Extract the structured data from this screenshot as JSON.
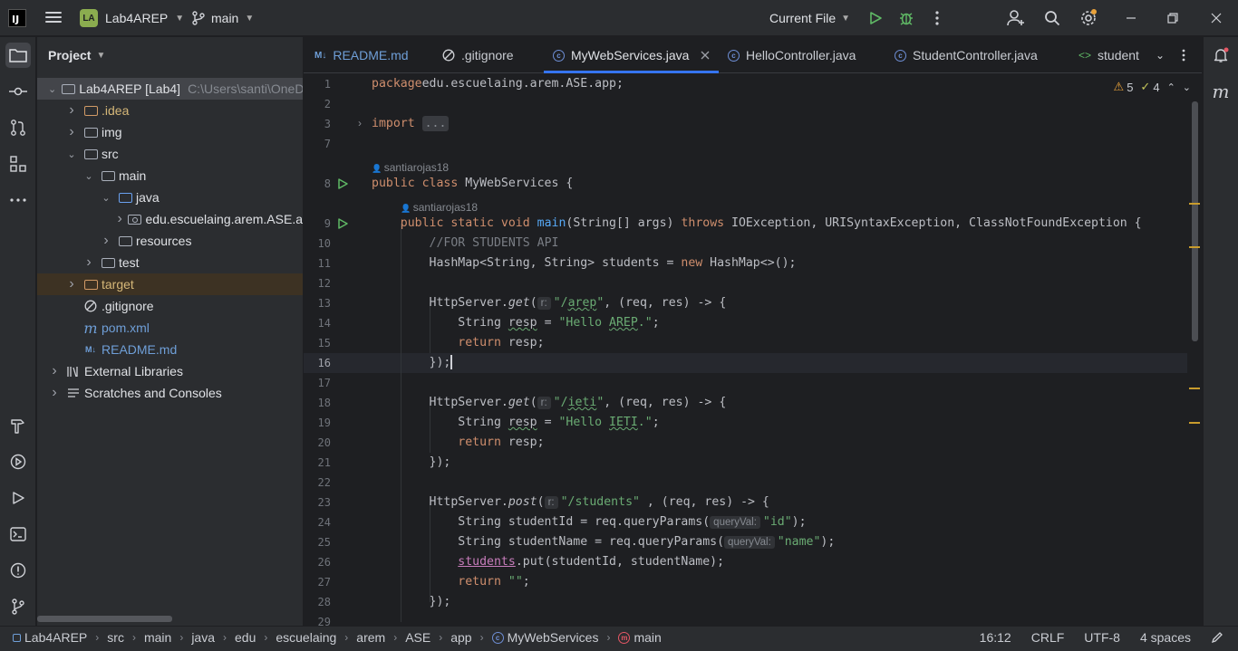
{
  "titlebar": {
    "logo": "IJ",
    "project_badge": "LA",
    "project_name": "Lab4AREP",
    "branch": "main",
    "run_config": "Current File"
  },
  "project_panel": {
    "title": "Project",
    "tree": [
      {
        "label": "Lab4AREP [Lab4]",
        "path": "C:\\Users\\santi\\OneD",
        "depth": 0,
        "expanded": true,
        "type": "module"
      },
      {
        "label": ".idea",
        "depth": 1,
        "expanded": false,
        "type": "folder-orange"
      },
      {
        "label": "img",
        "depth": 1,
        "expanded": false,
        "type": "folder"
      },
      {
        "label": "src",
        "depth": 1,
        "expanded": true,
        "type": "folder"
      },
      {
        "label": "main",
        "depth": 2,
        "expanded": true,
        "type": "folder"
      },
      {
        "label": "java",
        "depth": 3,
        "expanded": true,
        "type": "folder-blue"
      },
      {
        "label": "edu.escuelaing.arem.ASE.a",
        "depth": 4,
        "expanded": false,
        "type": "package"
      },
      {
        "label": "resources",
        "depth": 3,
        "expanded": false,
        "type": "folder"
      },
      {
        "label": "test",
        "depth": 2,
        "expanded": false,
        "type": "folder"
      },
      {
        "label": "target",
        "depth": 1,
        "expanded": false,
        "type": "folder-excluded"
      },
      {
        "label": ".gitignore",
        "depth": 1,
        "type": "gitignore"
      },
      {
        "label": "pom.xml",
        "depth": 1,
        "type": "maven"
      },
      {
        "label": "README.md",
        "depth": 1,
        "type": "markdown"
      },
      {
        "label": "External Libraries",
        "depth": 0,
        "expanded": false,
        "type": "libraries"
      },
      {
        "label": "Scratches and Consoles",
        "depth": 0,
        "expanded": false,
        "type": "scratches"
      }
    ]
  },
  "tabs": [
    {
      "label": "README.md",
      "icon": "markdown-icon",
      "active": false
    },
    {
      "label": ".gitignore",
      "icon": "gitignore-icon",
      "active": false
    },
    {
      "label": "MyWebServices.java",
      "icon": "class-icon",
      "active": true
    },
    {
      "label": "HelloController.java",
      "icon": "class-icon",
      "active": false
    },
    {
      "label": "StudentController.java",
      "icon": "class-icon",
      "active": false
    },
    {
      "label": "student",
      "icon": "html-icon",
      "active": false
    }
  ],
  "editor": {
    "warnings": "5",
    "weak_warnings": "4",
    "current_line": "16",
    "authors": [
      "santiarojas18",
      "santiarojas18"
    ],
    "lines": [
      {
        "n": "1",
        "tokens": [
          [
            "kw",
            "package"
          ],
          [
            "",
            "edu.escuelaing.arem.ASE.app;"
          ]
        ]
      },
      {
        "n": "2",
        "tokens": []
      },
      {
        "n": "3",
        "tokens": [
          [
            "kw",
            "import"
          ],
          [
            "",
            " "
          ],
          [
            "fold",
            "..."
          ]
        ]
      },
      {
        "n": "7",
        "tokens": []
      },
      {
        "n": "8",
        "tokens": [
          [
            "kw",
            "public class"
          ],
          [
            "",
            " MyWebServices {"
          ]
        ]
      },
      {
        "n": "9",
        "tokens": [
          [
            "",
            "    "
          ],
          [
            "kw",
            "public static void"
          ],
          [
            "",
            " "
          ],
          [
            "fn",
            "main"
          ],
          [
            "",
            "(String[] args) "
          ],
          [
            "kw",
            "throws"
          ],
          [
            "",
            " IOException, URISyntaxException, ClassNotFoundException {"
          ]
        ]
      },
      {
        "n": "10",
        "tokens": [
          [
            "",
            "        "
          ],
          [
            "cm",
            "//FOR STUDENTS API"
          ]
        ]
      },
      {
        "n": "11",
        "tokens": [
          [
            "",
            "        HashMap<String, String> students = "
          ],
          [
            "kw",
            "new"
          ],
          [
            "",
            " HashMap<>();"
          ]
        ]
      },
      {
        "n": "12",
        "tokens": []
      },
      {
        "n": "13",
        "tokens": [
          [
            "",
            "        HttpServer."
          ],
          [
            "it",
            "get"
          ],
          [
            "",
            "("
          ],
          [
            "hint",
            "r:"
          ],
          [
            "str",
            "\"/"
          ],
          [
            "strtypo",
            "arep"
          ],
          [
            "str",
            "\""
          ],
          [
            "",
            ", (req, res) -> {"
          ]
        ]
      },
      {
        "n": "14",
        "tokens": [
          [
            "",
            "            String "
          ],
          [
            "typo",
            "resp"
          ],
          [
            "",
            " = "
          ],
          [
            "str",
            "\"Hello "
          ],
          [
            "strtypo",
            "AREP"
          ],
          [
            "str",
            ".\""
          ],
          [
            "",
            ";"
          ]
        ]
      },
      {
        "n": "15",
        "tokens": [
          [
            "",
            "            "
          ],
          [
            "kw",
            "return"
          ],
          [
            "",
            " resp;"
          ]
        ]
      },
      {
        "n": "16",
        "tokens": [
          [
            "",
            "        });"
          ],
          [
            "caret",
            ""
          ]
        ]
      },
      {
        "n": "17",
        "tokens": []
      },
      {
        "n": "18",
        "tokens": [
          [
            "",
            "        HttpServer."
          ],
          [
            "it",
            "get"
          ],
          [
            "",
            "("
          ],
          [
            "hint",
            "r:"
          ],
          [
            "str",
            "\"/"
          ],
          [
            "strtypo",
            "ieti"
          ],
          [
            "str",
            "\""
          ],
          [
            "",
            ", (req, res) -> {"
          ]
        ]
      },
      {
        "n": "19",
        "tokens": [
          [
            "",
            "            String "
          ],
          [
            "typo",
            "resp"
          ],
          [
            "",
            " = "
          ],
          [
            "str",
            "\"Hello "
          ],
          [
            "strtypo",
            "IETI"
          ],
          [
            "str",
            ".\""
          ],
          [
            "",
            ";"
          ]
        ]
      },
      {
        "n": "20",
        "tokens": [
          [
            "",
            "            "
          ],
          [
            "kw",
            "return"
          ],
          [
            "",
            " resp;"
          ]
        ]
      },
      {
        "n": "21",
        "tokens": [
          [
            "",
            "        });"
          ]
        ]
      },
      {
        "n": "22",
        "tokens": []
      },
      {
        "n": "23",
        "tokens": [
          [
            "",
            "        HttpServer."
          ],
          [
            "it",
            "post"
          ],
          [
            "",
            "("
          ],
          [
            "hint",
            "r:"
          ],
          [
            "str",
            "\"/students\""
          ],
          [
            "",
            " , (req, res) -> {"
          ]
        ]
      },
      {
        "n": "24",
        "tokens": [
          [
            "",
            "            String studentId = req.queryParams("
          ],
          [
            "hint",
            "queryVal:"
          ],
          [
            "str",
            "\"id\""
          ],
          [
            "",
            ");"
          ]
        ]
      },
      {
        "n": "25",
        "tokens": [
          [
            "",
            "            String studentName = req.queryParams("
          ],
          [
            "hint",
            "queryVal:"
          ],
          [
            "str",
            "\"name\""
          ],
          [
            "",
            ");"
          ]
        ]
      },
      {
        "n": "26",
        "tokens": [
          [
            "",
            "            "
          ],
          [
            "fld",
            "students"
          ],
          [
            "",
            ".put(studentId, studentName);"
          ]
        ]
      },
      {
        "n": "27",
        "tokens": [
          [
            "",
            "            "
          ],
          [
            "kw",
            "return"
          ],
          [
            "",
            " "
          ],
          [
            "str",
            "\"\""
          ],
          [
            "",
            ";"
          ]
        ]
      },
      {
        "n": "28",
        "tokens": [
          [
            "",
            "        });"
          ]
        ]
      },
      {
        "n": "29",
        "tokens": []
      }
    ]
  },
  "statusbar": {
    "breadcrumbs": [
      "Lab4AREP",
      "src",
      "main",
      "java",
      "edu",
      "escuelaing",
      "arem",
      "ASE",
      "app",
      "MyWebServices",
      "main"
    ],
    "position": "16:12",
    "line_separator": "CRLF",
    "encoding": "UTF-8",
    "indent": "4 spaces"
  },
  "colors": {
    "accent": "#3574f0",
    "keyword": "#cf8e6d",
    "string": "#6aab73",
    "method": "#56a8f5",
    "warning": "#e9a23b"
  }
}
